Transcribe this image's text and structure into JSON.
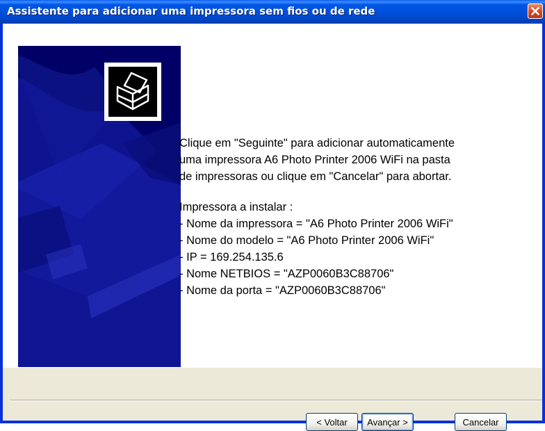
{
  "window": {
    "title": "Assistente para adicionar uma impressora sem fios ou de rede",
    "close_icon": "close-icon"
  },
  "side_panel": {
    "icon": "printer-icon",
    "background_color": "#000066"
  },
  "body": {
    "intro_lines": [
      "Clique em \"Seguinte\" para adicionar automaticamente",
      "uma impressora A6 Photo Printer 2006 WiFi na pasta",
      "de impressoras ou clique em \"Cancelar\" para abortar."
    ],
    "install_heading": "Impressora a instalar :",
    "details": [
      "- Nome da impressora = \"A6 Photo Printer 2006 WiFi\"",
      "- Nome do modelo = \"A6 Photo Printer 2006 WiFi\"",
      "- IP = 169.254.135.6",
      "- Nome NETBIOS = \"AZP0060B3C88706\"",
      "- Nome da porta = \"AZP0060B3C88706\""
    ]
  },
  "buttons": {
    "back_label": "< Voltar",
    "next_label": "Avançar >",
    "cancel_label": "Cancelar"
  },
  "colors": {
    "titlebar": "#0055e5",
    "window_frame": "#0831d9",
    "dialog_bg": "#ece9d8",
    "close_button": "#d5461f"
  }
}
